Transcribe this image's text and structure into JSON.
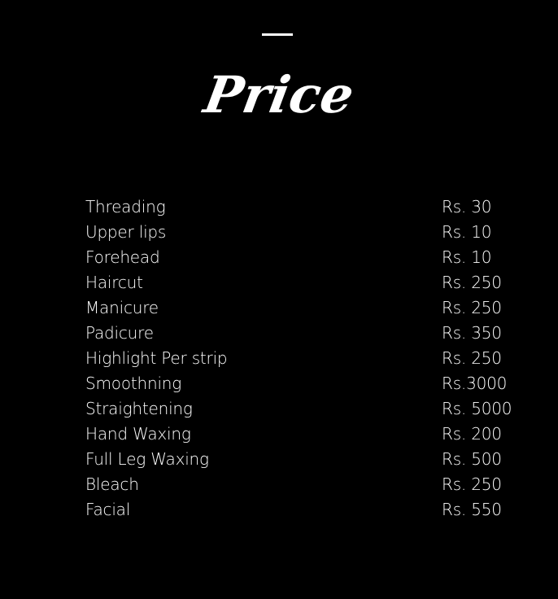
{
  "header": {
    "title": "Price"
  },
  "prices": [
    {
      "service": "Threading",
      "price": "Rs. 30"
    },
    {
      "service": "Upper lips",
      "price": "Rs. 10"
    },
    {
      "service": "Forehead",
      "price": "Rs. 10"
    },
    {
      "service": "Haircut",
      "price": "Rs. 250"
    },
    {
      "service": "Manicure",
      "price": "Rs. 250"
    },
    {
      "service": "Padicure",
      "price": "Rs. 350"
    },
    {
      "service": "Highlight Per strip",
      "price": "Rs. 250"
    },
    {
      "service": "Smoothning",
      "price": "Rs.3000"
    },
    {
      "service": "Straightening",
      "price": "Rs. 5000"
    },
    {
      "service": "Hand Waxing",
      "price": "Rs. 200"
    },
    {
      "service": "Full Leg Waxing",
      "price": "Rs. 500"
    },
    {
      "service": "Bleach",
      "price": "Rs. 250"
    },
    {
      "service": "Facial",
      "price": "Rs. 550"
    }
  ]
}
